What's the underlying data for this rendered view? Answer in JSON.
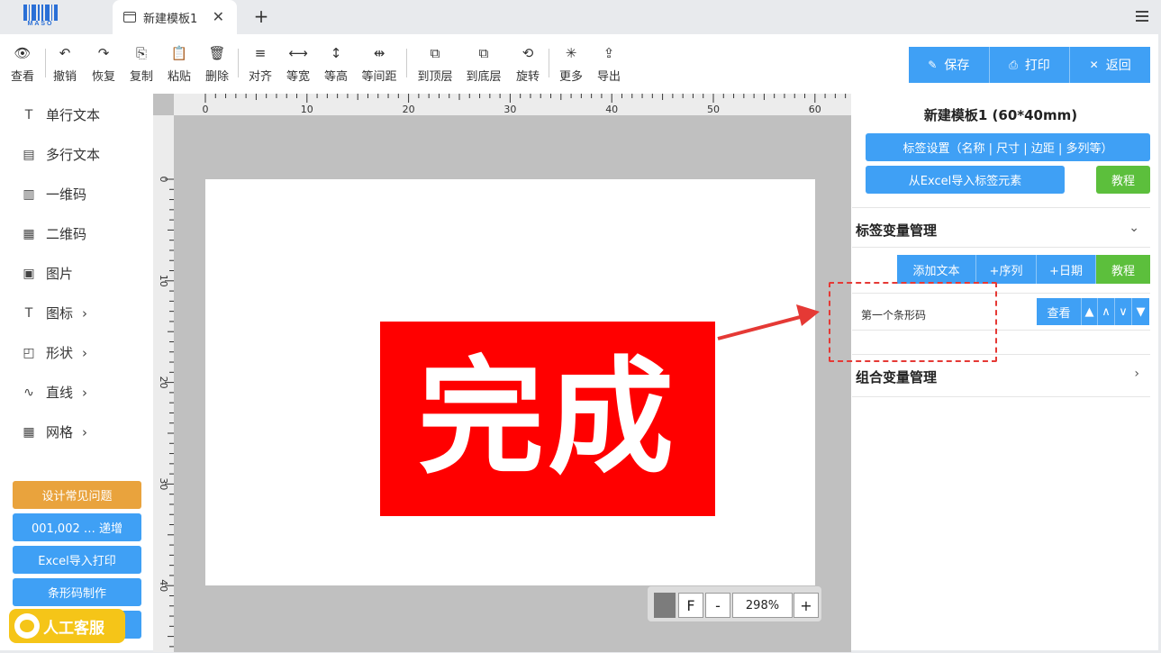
{
  "app": {
    "logo_text": "MASO",
    "tab_title": "新建模板1",
    "tab_close": "✕",
    "new_tab": "+"
  },
  "toolbar": {
    "items": [
      {
        "label": "查看",
        "icon": "eye-icon",
        "glyph": "👁"
      },
      {
        "label": "撤销",
        "icon": "undo-icon",
        "glyph": "↶"
      },
      {
        "label": "恢复",
        "icon": "redo-icon",
        "glyph": "↷"
      },
      {
        "label": "复制",
        "icon": "copy-icon",
        "glyph": "⎘"
      },
      {
        "label": "粘贴",
        "icon": "paste-icon",
        "glyph": "📋"
      },
      {
        "label": "删除",
        "icon": "trash-icon",
        "glyph": "🗑"
      },
      {
        "label": "对齐",
        "icon": "align-icon",
        "glyph": "≡"
      },
      {
        "label": "等宽",
        "icon": "equal-width-icon",
        "glyph": "⟷"
      },
      {
        "label": "等高",
        "icon": "equal-height-icon",
        "glyph": "↕"
      },
      {
        "label": "等间距",
        "icon": "equal-spacing-icon",
        "glyph": "⇹"
      },
      {
        "label": "到顶层",
        "icon": "bring-front-icon",
        "glyph": "⧉"
      },
      {
        "label": "到底层",
        "icon": "send-back-icon",
        "glyph": "⧉"
      },
      {
        "label": "旋转",
        "icon": "rotate-icon",
        "glyph": "⟲"
      },
      {
        "label": "更多",
        "icon": "more-icon",
        "glyph": "✳"
      },
      {
        "label": "导出",
        "icon": "export-icon",
        "glyph": "⇪"
      }
    ],
    "save_label": "保存",
    "print_label": "打印",
    "back_label": "返回"
  },
  "left_panel": {
    "items": [
      {
        "label": "单行文本",
        "icon": "text-icon",
        "glyph": "T",
        "has_submenu": false
      },
      {
        "label": "多行文本",
        "icon": "multiline-text-icon",
        "glyph": "▤",
        "has_submenu": false
      },
      {
        "label": "一维码",
        "icon": "barcode-icon",
        "glyph": "▥",
        "has_submenu": false
      },
      {
        "label": "二维码",
        "icon": "qrcode-icon",
        "glyph": "▦",
        "has_submenu": false
      },
      {
        "label": "图片",
        "icon": "image-icon",
        "glyph": "▣",
        "has_submenu": false
      },
      {
        "label": "图标",
        "icon": "icon-icon",
        "glyph": "T",
        "has_submenu": true
      },
      {
        "label": "形状",
        "icon": "shape-icon",
        "glyph": "◰",
        "has_submenu": true
      },
      {
        "label": "直线",
        "icon": "line-icon",
        "glyph": "∿",
        "has_submenu": true
      },
      {
        "label": "网格",
        "icon": "grid-icon",
        "glyph": "▦",
        "has_submenu": true
      }
    ],
    "chevron": "›",
    "help_buttons": [
      {
        "label": "设计常见问题",
        "color": "#e9a33d"
      },
      {
        "label": "001,002 … 递增",
        "color": "#3fa0f5"
      },
      {
        "label": "Excel导入打印",
        "color": "#3fa0f5"
      },
      {
        "label": "条形码制作",
        "color": "#3fa0f5"
      }
    ],
    "support_label": "人工客服"
  },
  "canvas": {
    "ruler_top_labels": [
      "0",
      "10",
      "20",
      "30",
      "40",
      "50",
      "60"
    ],
    "ruler_left_labels": [
      "0",
      "10",
      "20",
      "30",
      "40"
    ],
    "element_text": "完成",
    "element_color": "#ff0000",
    "zoom": {
      "font_button": "F",
      "minus": "-",
      "value": "298%",
      "plus": "+"
    }
  },
  "right_panel": {
    "title": "新建模板1 (60*40mm)",
    "label_settings_button": "标签设置（名称 | 尺寸 | 边距 | 多列等）",
    "excel_import_button": "从Excel导入标签元素",
    "tutorial_button": "教程",
    "var_section_title": "标签变量管理",
    "var_buttons": {
      "add_text": "添加文本",
      "add_sequence": "+序列",
      "add_date": "+日期",
      "tutorial": "教程"
    },
    "variables": [
      {
        "name": "第一个条形码",
        "view": "查看"
      }
    ],
    "combo_section_title": "组合变量管理",
    "accent_blue": "#3fa0f5",
    "accent_green": "#5cbf3c"
  }
}
